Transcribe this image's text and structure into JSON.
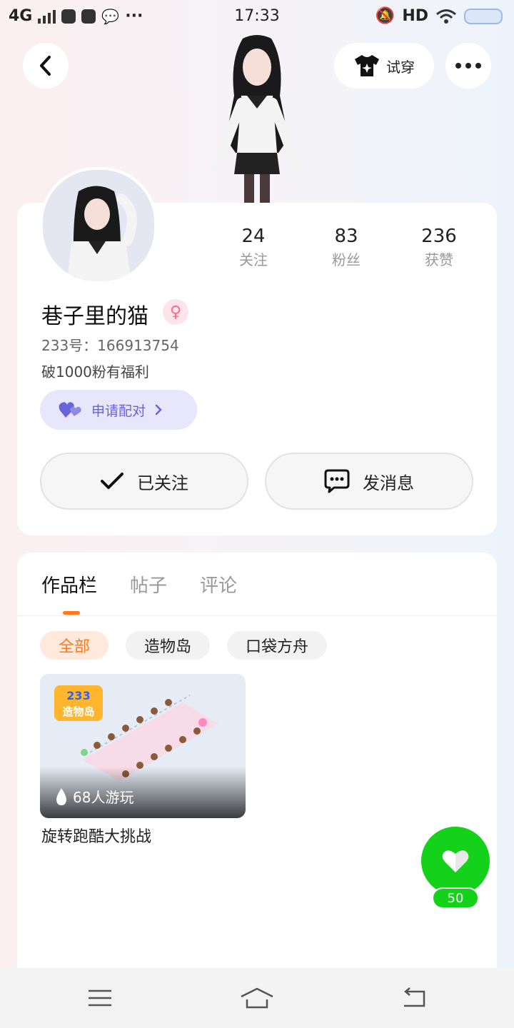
{
  "status_bar": {
    "network": "4G",
    "time": "17:33",
    "hd": "HD"
  },
  "header": {
    "tryon_label": "试穿"
  },
  "profile": {
    "username": "巷子里的猫",
    "gender_symbol": "♀",
    "uid": "233号：166913754",
    "bio": "破1000粉有福利",
    "pair_label": "申请配对",
    "stats": [
      {
        "num": "24",
        "label": "关注"
      },
      {
        "num": "83",
        "label": "粉丝"
      },
      {
        "num": "236",
        "label": "获赞"
      }
    ],
    "follow_label": "已关注",
    "message_label": "发消息"
  },
  "works": {
    "tabs": [
      {
        "label": "作品栏",
        "active": true
      },
      {
        "label": "帖子",
        "active": false
      },
      {
        "label": "评论",
        "active": false
      }
    ],
    "filters": [
      {
        "label": "全部",
        "active": true
      },
      {
        "label": "造物岛",
        "active": false
      },
      {
        "label": "口袋方舟",
        "active": false
      }
    ],
    "items": [
      {
        "title": "旋转跑酷大挑战",
        "play_count": "68人游玩",
        "logo_text": "233 造物岛"
      }
    ]
  },
  "like": {
    "count": "50"
  },
  "colors": {
    "accent": "#ff7a1a",
    "like_green": "#14d11a",
    "pair_purple": "#6c63d8"
  }
}
